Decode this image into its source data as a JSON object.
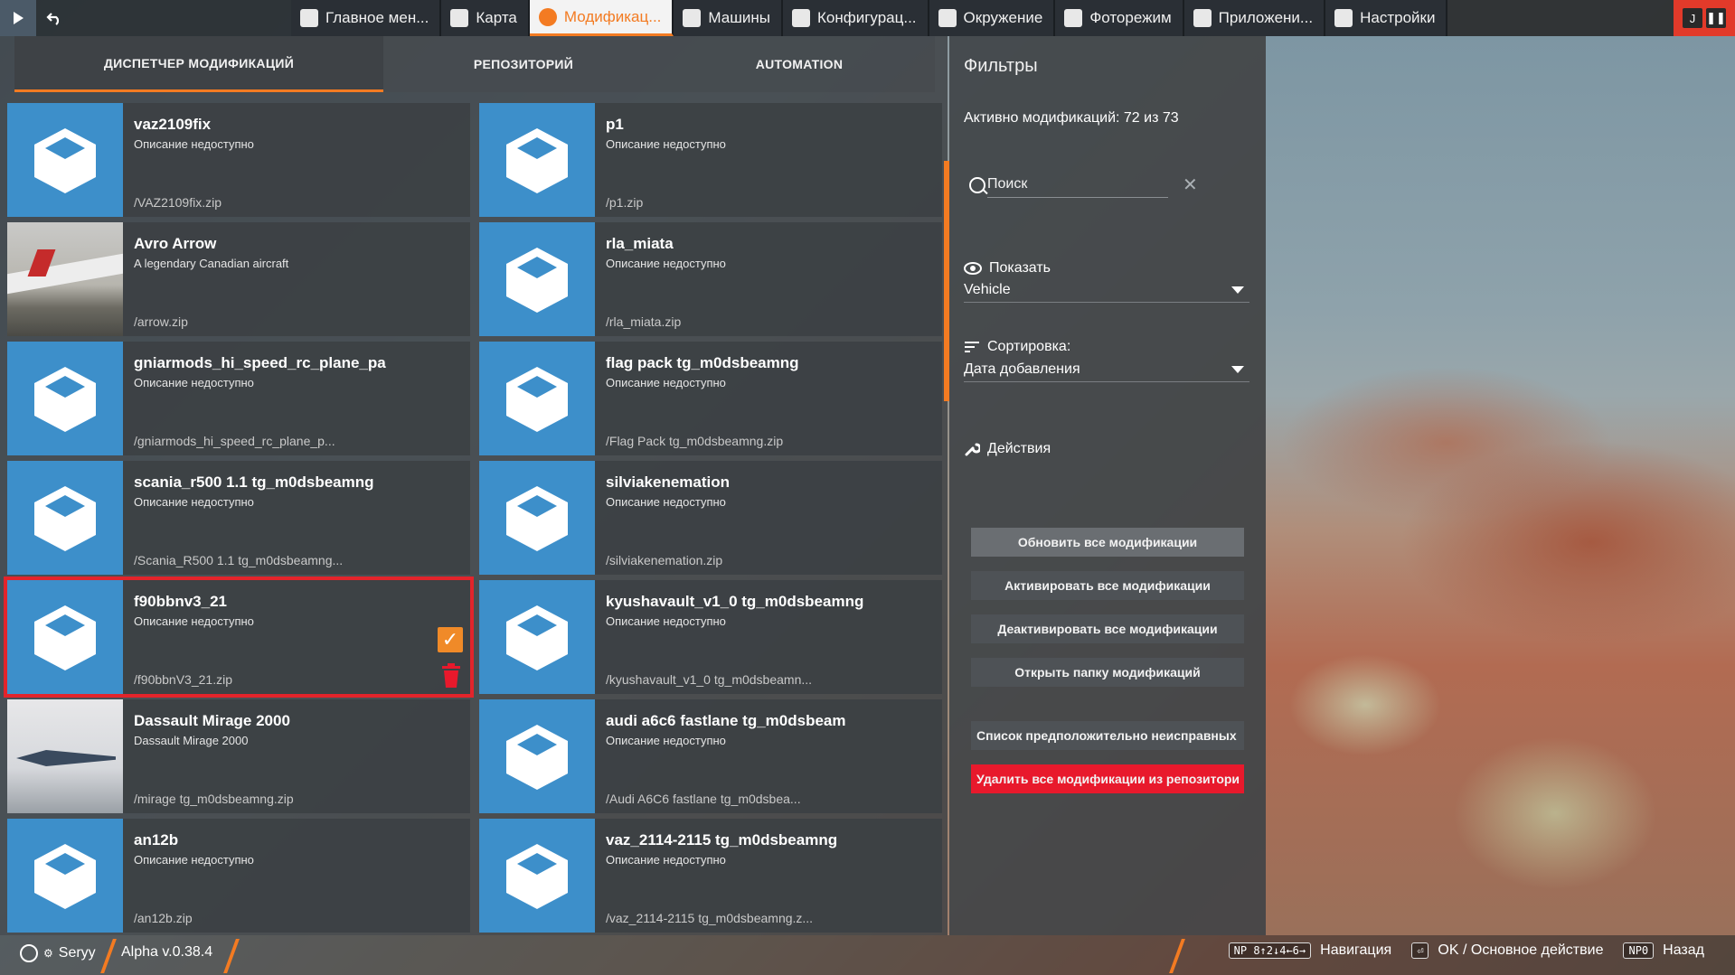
{
  "topbar": {
    "tabs": [
      {
        "label": "Главное мен...",
        "icon": "dashboard-icon"
      },
      {
        "label": "Карта",
        "icon": "map-icon"
      },
      {
        "label": "Модификац...",
        "icon": "puzzle-icon",
        "active": true
      },
      {
        "label": "Машины",
        "icon": "car-icon"
      },
      {
        "label": "Конфигурац...",
        "icon": "engine-icon"
      },
      {
        "label": "Окружение",
        "icon": "weather-icon"
      },
      {
        "label": "Фоторежим",
        "icon": "camera-icon"
      },
      {
        "label": "Приложени...",
        "icon": "apps-icon"
      },
      {
        "label": "Настройки",
        "icon": "sliders-icon"
      }
    ],
    "right_badge": "J"
  },
  "subtabs": [
    "ДИСПЕТЧЕР МОДИФИКАЦИЙ",
    "РЕПОЗИТОРИЙ",
    "AUTOMATION"
  ],
  "mods": [
    {
      "title": "vaz2109fix",
      "desc": "Описание недоступно",
      "file": "/VAZ2109fix.zip",
      "thumb": "cube"
    },
    {
      "title": "p1",
      "desc": "Описание недоступно",
      "file": "/p1.zip",
      "thumb": "cube"
    },
    {
      "title": "Avro Arrow",
      "desc": "A legendary Canadian aircraft",
      "file": "/arrow.zip",
      "thumb": "photo"
    },
    {
      "title": "rla_miata",
      "desc": "Описание недоступно",
      "file": "/rla_miata.zip",
      "thumb": "cube"
    },
    {
      "title": "gniarmods_hi_speed_rc_plane_pa",
      "desc": "Описание недоступно",
      "file": "/gniarmods_hi_speed_rc_plane_p...",
      "thumb": "cube"
    },
    {
      "title": "flag pack tg_m0dsbeamng",
      "desc": "Описание недоступно",
      "file": "/Flag Pack tg_m0dsbeamng.zip",
      "thumb": "cube"
    },
    {
      "title": "scania_r500 1.1 tg_m0dsbeamng",
      "desc": "Описание недоступно",
      "file": "/Scania_R500 1.1 tg_m0dsbeamng...",
      "thumb": "cube"
    },
    {
      "title": "silviakenemation",
      "desc": "Описание недоступно",
      "file": "/silviakenemation.zip",
      "thumb": "cube"
    },
    {
      "title": "f90bbnv3_21",
      "desc": "Описание недоступно",
      "file": "/f90bbnV3_21.zip",
      "thumb": "cube",
      "selected": true
    },
    {
      "title": "kyushavault_v1_0 tg_m0dsbeamng",
      "desc": "Описание недоступно",
      "file": "/kyushavault_v1_0 tg_m0dsbeamn...",
      "thumb": "cube"
    },
    {
      "title": "Dassault Mirage 2000",
      "desc": "Dassault Mirage 2000",
      "file": "/mirage tg_m0dsbeamng.zip",
      "thumb": "photo2"
    },
    {
      "title": "audi a6c6 fastlane tg_m0dsbeam",
      "desc": "Описание недоступно",
      "file": "/Audi A6C6 fastlane tg_m0dsbea...",
      "thumb": "cube"
    },
    {
      "title": "an12b",
      "desc": "Описание недоступно",
      "file": "/an12b.zip",
      "thumb": "cube"
    },
    {
      "title": "vaz_2114-2115 tg_m0dsbeamng",
      "desc": "Описание недоступно",
      "file": "/vaz_2114-2115 tg_m0dsbeamng.z...",
      "thumb": "cube"
    }
  ],
  "filters": {
    "heading": "Фильтры",
    "active_count": "Активно модификаций: 72 из 73",
    "search_placeholder": "Поиск",
    "show_label": "Показать",
    "show_value": "Vehicle",
    "sort_label": "Сортировка:",
    "sort_value": "Дата добавления",
    "actions_label": "Действия",
    "buttons": [
      "Обновить все модификации",
      "Активировать все модификации",
      "Деактивировать все модификации",
      "Открыть папку модификаций",
      "Список предположительно неисправных",
      "Удалить все модификации из репозитори"
    ]
  },
  "bottombar": {
    "user": "Seryy",
    "version": "Alpha v.0.38.4",
    "hints": [
      {
        "key": "NP 8↑2↓4←6→",
        "label": "Навигация"
      },
      {
        "key": "⏎",
        "label": "OK / Основное действие"
      },
      {
        "key": "NP0",
        "label": "Назад"
      }
    ]
  },
  "colors": {
    "accent": "#f37b22",
    "danger": "#e8192c",
    "mod_blue": "#3d8fca"
  }
}
